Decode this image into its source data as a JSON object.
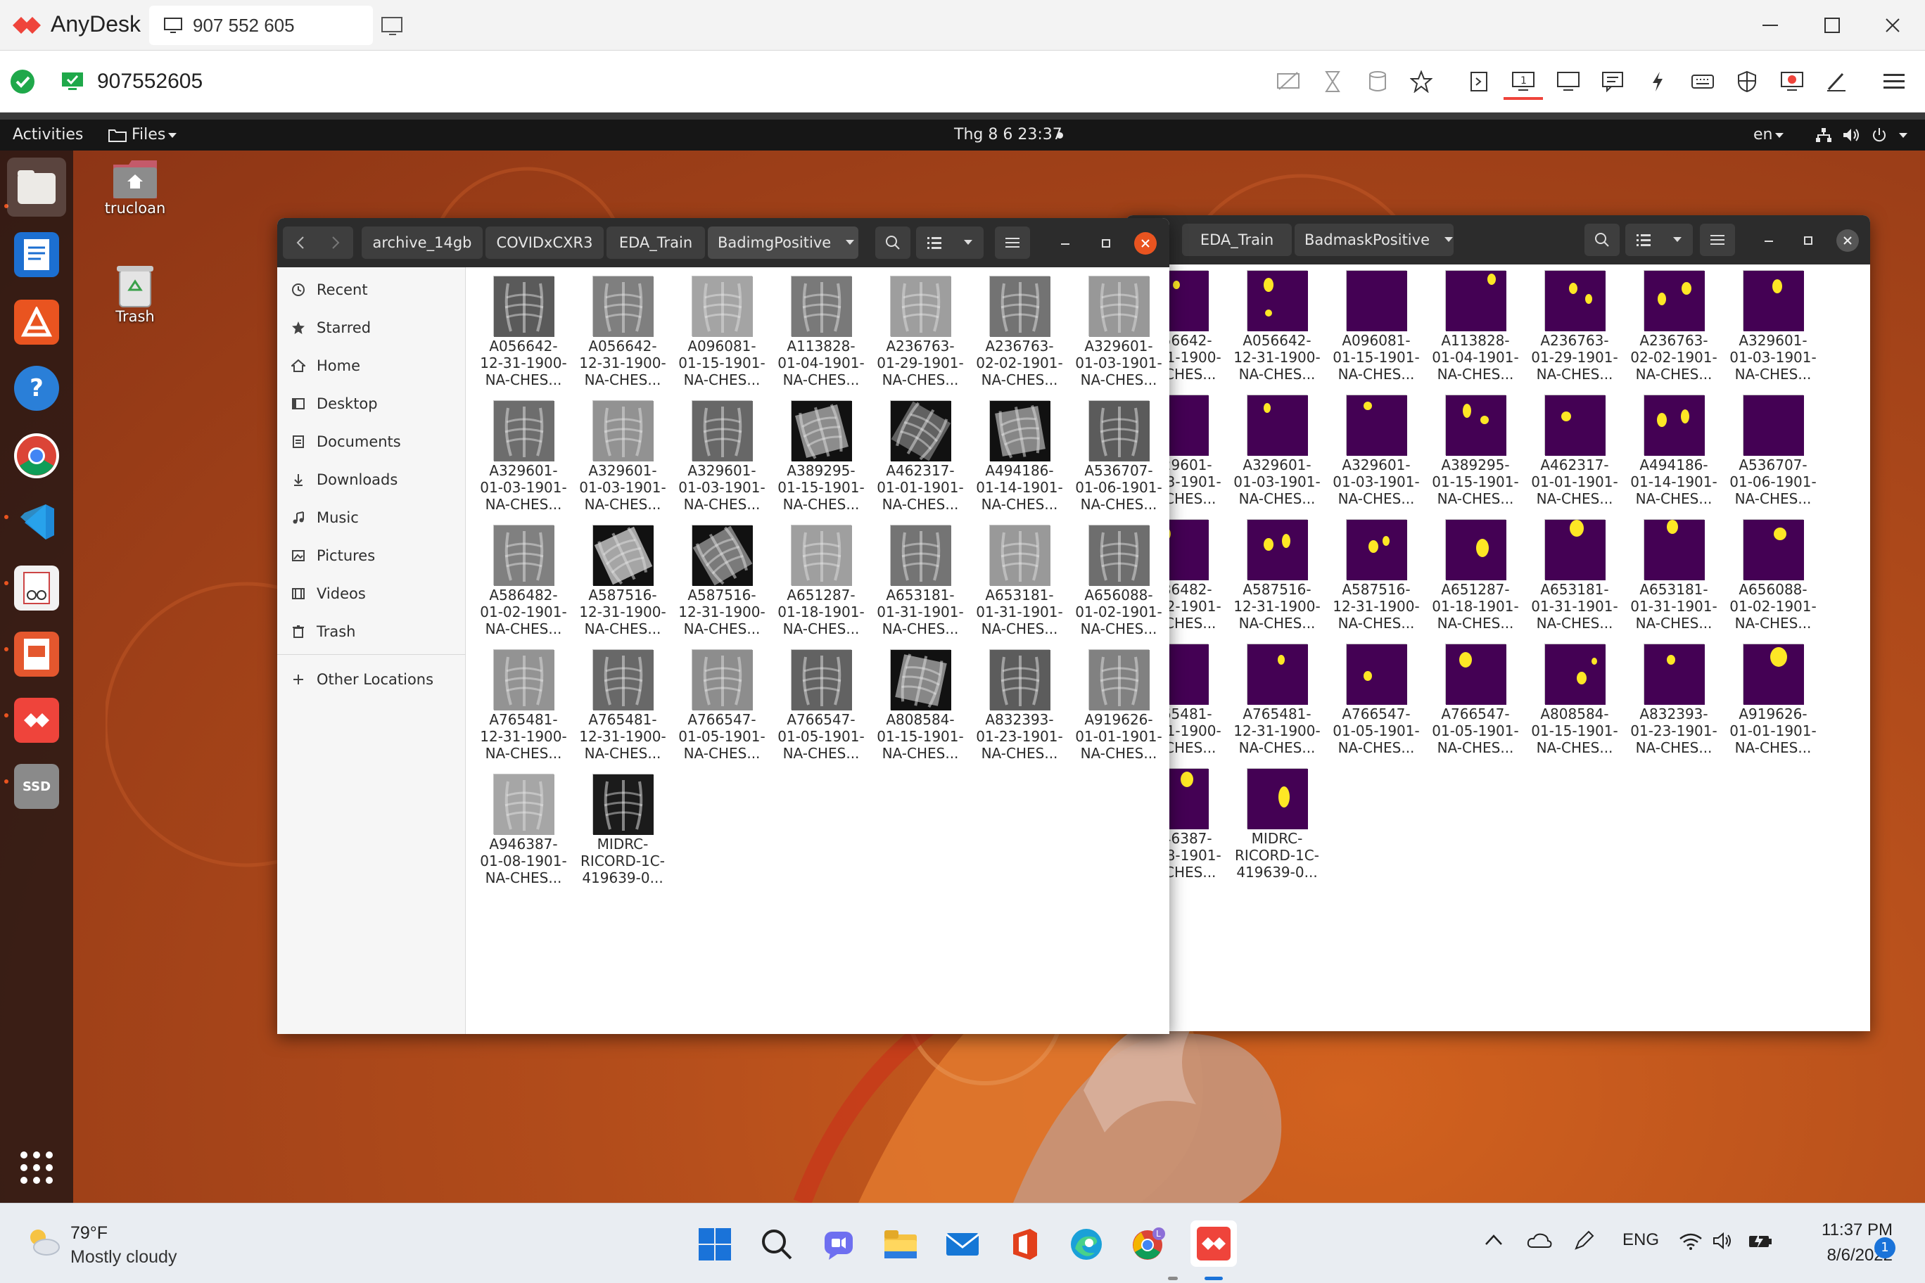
{
  "anydesk": {
    "app_name": "AnyDesk",
    "tab_label": "907 552 605",
    "address_value": "907552605"
  },
  "ubuntu": {
    "activities": "Activities",
    "files_menu": "Files",
    "clock": "Thg 8 6  23:37",
    "lang": "en",
    "desktop_icons": [
      {
        "label": "trucloan"
      },
      {
        "label": "Trash"
      }
    ]
  },
  "left_window": {
    "breadcrumbs": [
      "archive_14gb",
      "COVIDxCXR3",
      "EDA_Train",
      "BadimgPositive"
    ],
    "sidebar": [
      "Recent",
      "Starred",
      "Home",
      "Desktop",
      "Documents",
      "Downloads",
      "Music",
      "Pictures",
      "Videos",
      "Trash"
    ],
    "other_locations": "Other Locations",
    "files": [
      {
        "l1": "A056642-",
        "l2": "12-31-1900-",
        "l3": "NA-CHES..."
      },
      {
        "l1": "A056642-",
        "l2": "12-31-1900-",
        "l3": "NA-CHES..."
      },
      {
        "l1": "A096081-",
        "l2": "01-15-1901-",
        "l3": "NA-CHES..."
      },
      {
        "l1": "A113828-",
        "l2": "01-04-1901-",
        "l3": "NA-CHES..."
      },
      {
        "l1": "A236763-",
        "l2": "01-29-1901-",
        "l3": "NA-CHES..."
      },
      {
        "l1": "A236763-",
        "l2": "02-02-1901-",
        "l3": "NA-CHES..."
      },
      {
        "l1": "A329601-",
        "l2": "01-03-1901-",
        "l3": "NA-CHES..."
      },
      {
        "l1": "A329601-",
        "l2": "01-03-1901-",
        "l3": "NA-CHES..."
      },
      {
        "l1": "A329601-",
        "l2": "01-03-1901-",
        "l3": "NA-CHES..."
      },
      {
        "l1": "A329601-",
        "l2": "01-03-1901-",
        "l3": "NA-CHES..."
      },
      {
        "l1": "A389295-",
        "l2": "01-15-1901-",
        "l3": "NA-CHES..."
      },
      {
        "l1": "A462317-",
        "l2": "01-01-1901-",
        "l3": "NA-CHES..."
      },
      {
        "l1": "A494186-",
        "l2": "01-14-1901-",
        "l3": "NA-CHES..."
      },
      {
        "l1": "A536707-",
        "l2": "01-06-1901-",
        "l3": "NA-CHES..."
      },
      {
        "l1": "A586482-",
        "l2": "01-02-1901-",
        "l3": "NA-CHES..."
      },
      {
        "l1": "A587516-",
        "l2": "12-31-1900-",
        "l3": "NA-CHES..."
      },
      {
        "l1": "A587516-",
        "l2": "12-31-1900-",
        "l3": "NA-CHES..."
      },
      {
        "l1": "A651287-",
        "l2": "01-18-1901-",
        "l3": "NA-CHES..."
      },
      {
        "l1": "A653181-",
        "l2": "01-31-1901-",
        "l3": "NA-CHES..."
      },
      {
        "l1": "A653181-",
        "l2": "01-31-1901-",
        "l3": "NA-CHES..."
      },
      {
        "l1": "A656088-",
        "l2": "01-02-1901-",
        "l3": "NA-CHES..."
      },
      {
        "l1": "A765481-",
        "l2": "12-31-1900-",
        "l3": "NA-CHES..."
      },
      {
        "l1": "A765481-",
        "l2": "12-31-1900-",
        "l3": "NA-CHES..."
      },
      {
        "l1": "A766547-",
        "l2": "01-05-1901-",
        "l3": "NA-CHES..."
      },
      {
        "l1": "A766547-",
        "l2": "01-05-1901-",
        "l3": "NA-CHES..."
      },
      {
        "l1": "A808584-",
        "l2": "01-15-1901-",
        "l3": "NA-CHES..."
      },
      {
        "l1": "A832393-",
        "l2": "01-23-1901-",
        "l3": "NA-CHES..."
      },
      {
        "l1": "A919626-",
        "l2": "01-01-1901-",
        "l3": "NA-CHES..."
      },
      {
        "l1": "A946387-",
        "l2": "01-08-1901-",
        "l3": "NA-CHES..."
      },
      {
        "l1": "MIDRC-",
        "l2": "RICORD-1C-",
        "l3": "419639-0..."
      }
    ]
  },
  "right_window": {
    "breadcrumbs": [
      "EDA_Train",
      "BadmaskPositive"
    ],
    "files": [
      {
        "l1": "A056642-",
        "l2": "12-31-1900-",
        "l3": "NA-CHES..."
      },
      {
        "l1": "A056642-",
        "l2": "12-31-1900-",
        "l3": "NA-CHES..."
      },
      {
        "l1": "A096081-",
        "l2": "01-15-1901-",
        "l3": "NA-CHES..."
      },
      {
        "l1": "A113828-",
        "l2": "01-04-1901-",
        "l3": "NA-CHES..."
      },
      {
        "l1": "A236763-",
        "l2": "01-29-1901-",
        "l3": "NA-CHES..."
      },
      {
        "l1": "A236763-",
        "l2": "02-02-1901-",
        "l3": "NA-CHES..."
      },
      {
        "l1": "A329601-",
        "l2": "01-03-1901-",
        "l3": "NA-CHES..."
      },
      {
        "l1": "A329601-",
        "l2": "01-03-1901-",
        "l3": "NA-CHES..."
      },
      {
        "l1": "A329601-",
        "l2": "01-03-1901-",
        "l3": "NA-CHES..."
      },
      {
        "l1": "A329601-",
        "l2": "01-03-1901-",
        "l3": "NA-CHES..."
      },
      {
        "l1": "A389295-",
        "l2": "01-15-1901-",
        "l3": "NA-CHES..."
      },
      {
        "l1": "A462317-",
        "l2": "01-01-1901-",
        "l3": "NA-CHES..."
      },
      {
        "l1": "A494186-",
        "l2": "01-14-1901-",
        "l3": "NA-CHES..."
      },
      {
        "l1": "A536707-",
        "l2": "01-06-1901-",
        "l3": "NA-CHES..."
      },
      {
        "l1": "A586482-",
        "l2": "01-02-1901-",
        "l3": "NA-CHES..."
      },
      {
        "l1": "A587516-",
        "l2": "12-31-1900-",
        "l3": "NA-CHES..."
      },
      {
        "l1": "A587516-",
        "l2": "12-31-1900-",
        "l3": "NA-CHES..."
      },
      {
        "l1": "A651287-",
        "l2": "01-18-1901-",
        "l3": "NA-CHES..."
      },
      {
        "l1": "A653181-",
        "l2": "01-31-1901-",
        "l3": "NA-CHES..."
      },
      {
        "l1": "A653181-",
        "l2": "01-31-1901-",
        "l3": "NA-CHES..."
      },
      {
        "l1": "A656088-",
        "l2": "01-02-1901-",
        "l3": "NA-CHES..."
      },
      {
        "l1": "A765481-",
        "l2": "12-31-1900-",
        "l3": "NA-CHES..."
      },
      {
        "l1": "A765481-",
        "l2": "12-31-1900-",
        "l3": "NA-CHES..."
      },
      {
        "l1": "A766547-",
        "l2": "01-05-1901-",
        "l3": "NA-CHES..."
      },
      {
        "l1": "A766547-",
        "l2": "01-05-1901-",
        "l3": "NA-CHES..."
      },
      {
        "l1": "A808584-",
        "l2": "01-15-1901-",
        "l3": "NA-CHES..."
      },
      {
        "l1": "A832393-",
        "l2": "01-23-1901-",
        "l3": "NA-CHES..."
      },
      {
        "l1": "A919626-",
        "l2": "01-01-1901-",
        "l3": "NA-CHES..."
      },
      {
        "l1": "A946387-",
        "l2": "01-08-1901-",
        "l3": "NA-CHES..."
      },
      {
        "l1": "MIDRC-",
        "l2": "RICORD-1C-",
        "l3": "419639-0..."
      }
    ]
  },
  "taskbar": {
    "weather_temp": "79°F",
    "weather_desc": "Mostly cloudy",
    "lang": "ENG",
    "time": "11:37 PM",
    "date": "8/6/2022",
    "notification_count": "1"
  },
  "colors": {
    "anydesk_red": "#ef443b",
    "mask_purple": "#440154",
    "mask_yellow": "#fde725",
    "ubuntu_orange": "#e95420"
  }
}
